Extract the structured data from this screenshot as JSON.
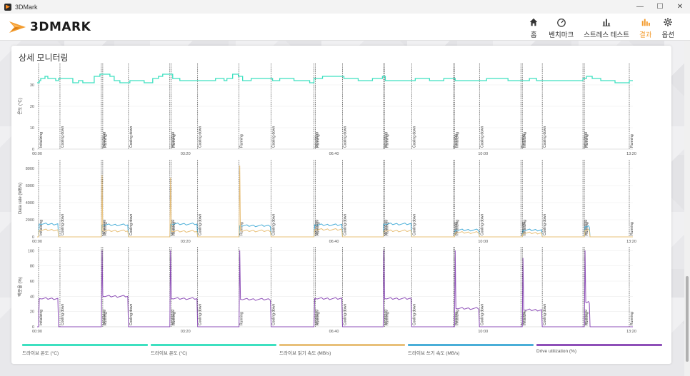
{
  "window": {
    "title": "3DMark",
    "controls": [
      "—",
      "☐",
      "✕"
    ]
  },
  "header": {
    "logo_text": "3DMARK",
    "nav": [
      {
        "label": "홈",
        "icon": "home-icon",
        "active": false
      },
      {
        "label": "벤치마크",
        "icon": "speedometer-icon",
        "active": false
      },
      {
        "label": "스트레스 테스트",
        "icon": "bar-chart-icon",
        "active": false
      },
      {
        "label": "결과",
        "icon": "results-icon",
        "active": true
      },
      {
        "label": "옵션",
        "icon": "gear-icon",
        "active": false
      }
    ]
  },
  "panel": {
    "title": "상세 모니터링"
  },
  "colors": {
    "teal": "#3de0c0",
    "orange": "#e8c07a",
    "blue": "#4aaed8",
    "purple": "#8e4fb8",
    "accent": "#f39c2f"
  },
  "chart_data": [
    {
      "type": "line",
      "ylabel": "온도 (°C)",
      "ylim": [
        0,
        40
      ],
      "yticks": [
        "0",
        "10",
        "20",
        "30"
      ],
      "xticks": [
        "00:00",
        "03:20",
        "06:40",
        "10:00",
        "13:20"
      ],
      "x": [
        0,
        3,
        5,
        11,
        15,
        26,
        30,
        50,
        58,
        64,
        80,
        88,
        99,
        102,
        108,
        116,
        130,
        150,
        162,
        170,
        176,
        190,
        200,
        230,
        250,
        262,
        266,
        274,
        282,
        288,
        300,
        330,
        340,
        360,
        382,
        388,
        400,
        430,
        450,
        470,
        484,
        488,
        500,
        530,
        550,
        570,
        586,
        600,
        630,
        660,
        690,
        700,
        730,
        765,
        770,
        778,
        790,
        810,
        830,
        835
      ],
      "series": [
        {
          "name": "드라이브 온도 (°C)",
          "color": "#3de0c0",
          "values": [
            31,
            32,
            33,
            34,
            33,
            32,
            33,
            31,
            32,
            31,
            34,
            35,
            35,
            34,
            32,
            31,
            32,
            31,
            33,
            34,
            35,
            33,
            32,
            32,
            33,
            32,
            33,
            35,
            34,
            32,
            33,
            32,
            33,
            32,
            31,
            33,
            34,
            33,
            32,
            33,
            34,
            32,
            32,
            33,
            32,
            33,
            32,
            32,
            33,
            32,
            33,
            32,
            32,
            33,
            34,
            33,
            32,
            31,
            32,
            32
          ]
        }
      ],
      "markers": [
        {
          "x": 2,
          "label": "Initializing"
        },
        {
          "x": 32,
          "label": "Cooling down"
        },
        {
          "x": 90,
          "label": "Initializing"
        },
        {
          "x": 92,
          "label": "Running"
        },
        {
          "x": 128,
          "label": "Cooling down"
        },
        {
          "x": 186,
          "label": "Initializing"
        },
        {
          "x": 188,
          "label": "Running"
        },
        {
          "x": 225,
          "label": "Cooling down"
        },
        {
          "x": 283,
          "label": "Running"
        },
        {
          "x": 328,
          "label": "Cooling down"
        },
        {
          "x": 388,
          "label": "Initializing"
        },
        {
          "x": 390,
          "label": "Running"
        },
        {
          "x": 428,
          "label": "Cooling down"
        },
        {
          "x": 485,
          "label": "Initializing"
        },
        {
          "x": 487,
          "label": "Running"
        },
        {
          "x": 525,
          "label": "Cooling down"
        },
        {
          "x": 583,
          "label": "Running"
        },
        {
          "x": 585,
          "label": "Initializing"
        },
        {
          "x": 620,
          "label": "Cooling down"
        },
        {
          "x": 678,
          "label": "Running"
        },
        {
          "x": 680,
          "label": "Initializing"
        },
        {
          "x": 708,
          "label": "Cooling down"
        },
        {
          "x": 765,
          "label": "Initializing"
        },
        {
          "x": 767,
          "label": "Running"
        },
        {
          "x": 830,
          "label": "Running"
        }
      ]
    },
    {
      "type": "line",
      "ylabel": "Data rate (MB/s)",
      "ylim": [
        0,
        9000
      ],
      "yticks": [
        "0",
        "2000",
        "4000",
        "6000",
        "8000"
      ],
      "xticks": [
        "00:00",
        "03:20",
        "06:40",
        "10:00",
        "13:20"
      ],
      "series": [
        {
          "name": "드라이브 쓰기 속도 (MB/s)",
          "color": "#4aaed8",
          "segments": [
            {
              "from": 2,
              "to": 30,
              "level": 1500,
              "spike": null
            },
            {
              "from": 90,
              "to": 128,
              "level": 1400,
              "spike": null
            },
            {
              "from": 186,
              "to": 225,
              "level": 1500,
              "spike": null
            },
            {
              "from": 283,
              "to": 328,
              "level": 1300,
              "spike": null
            },
            {
              "from": 388,
              "to": 428,
              "level": 1400,
              "spike": null
            },
            {
              "from": 485,
              "to": 525,
              "level": 1500,
              "spike": null
            },
            {
              "from": 585,
              "to": 620,
              "level": 800,
              "spike": null
            },
            {
              "from": 680,
              "to": 708,
              "level": 800,
              "spike": null
            },
            {
              "from": 767,
              "to": 775,
              "level": 1200,
              "spike": null
            }
          ]
        },
        {
          "name": "드라이브 읽기 속도 (MB/s)",
          "color": "#e8c07a",
          "segments": [
            {
              "from": 2,
              "to": 30,
              "level": 800,
              "spike": null
            },
            {
              "from": 90,
              "to": 128,
              "level": 700,
              "spike": 7200
            },
            {
              "from": 186,
              "to": 225,
              "level": 650,
              "spike": 6900
            },
            {
              "from": 283,
              "to": 328,
              "level": 700,
              "spike": 8300
            },
            {
              "from": 388,
              "to": 428,
              "level": 850,
              "spike": null
            },
            {
              "from": 485,
              "to": 525,
              "level": 700,
              "spike": null
            },
            {
              "from": 585,
              "to": 620,
              "level": 500,
              "spike": null
            },
            {
              "from": 680,
              "to": 708,
              "level": 450,
              "spike": null
            },
            {
              "from": 767,
              "to": 775,
              "level": 800,
              "spike": null
            }
          ]
        }
      ]
    },
    {
      "type": "line",
      "ylabel": "백분율 (%)",
      "ylim": [
        0,
        105
      ],
      "yticks": [
        "0",
        "20",
        "40",
        "60",
        "80",
        "100"
      ],
      "xticks": [
        "00:00",
        "03:20",
        "06:40",
        "10:00",
        "13:20"
      ],
      "series": [
        {
          "name": "Drive utilization (%)",
          "color": "#8e4fb8",
          "segments": [
            {
              "from": 2,
              "to": 30,
              "level": 37,
              "spike": null
            },
            {
              "from": 90,
              "to": 128,
              "level": 40,
              "spike": 100
            },
            {
              "from": 186,
              "to": 225,
              "level": 37,
              "spike": 100
            },
            {
              "from": 283,
              "to": 328,
              "level": 36,
              "spike": 100
            },
            {
              "from": 388,
              "to": 428,
              "level": 37,
              "spike": null
            },
            {
              "from": 485,
              "to": 525,
              "level": 37,
              "spike": 100
            },
            {
              "from": 585,
              "to": 620,
              "level": 24,
              "spike": 100
            },
            {
              "from": 680,
              "to": 708,
              "level": 22,
              "spike": 90
            },
            {
              "from": 767,
              "to": 775,
              "level": 32,
              "spike": 100
            }
          ]
        }
      ]
    }
  ],
  "legend": [
    {
      "label": "드라이브 온도 (°C)",
      "color": "#3de0c0"
    },
    {
      "label": "드라이브 온도 (°C)",
      "color": "#3de0c0"
    },
    {
      "label": "드라이브 읽기 속도 (MB/s)",
      "color": "#e8c07a"
    },
    {
      "label": "드라이브 쓰기 속도 (MB/s)",
      "color": "#4aaed8"
    },
    {
      "label": "Drive utilization (%)",
      "color": "#8e4fb8"
    }
  ]
}
